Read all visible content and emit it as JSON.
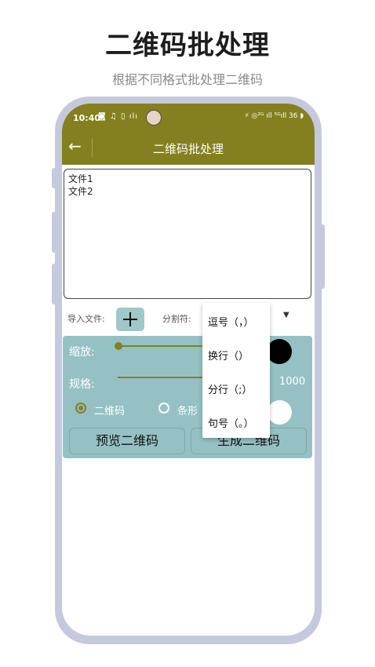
{
  "headline": "二维码批处理",
  "subheadline": "根据不同格式批处理二维码",
  "status": {
    "time": "10:40",
    "icons_left": "◙ ♫ ▯ ılı",
    "icons_right": "⚡ ◎²ᴳ ıll ⁵ᴳıll 36 ◗"
  },
  "app": {
    "title": "二维码批处理",
    "back_icon": "←"
  },
  "textarea": {
    "lines": [
      "文件1",
      "文件2"
    ]
  },
  "import": {
    "label": "导入文件:",
    "separator_label": "分割符:",
    "caret": "▼"
  },
  "settings": {
    "zoom_label": "缩放:",
    "spec_label": "规格:",
    "spec_value": "1000",
    "radio_qr": "二维码",
    "radio_bar": "条形",
    "preview_button": "预览二维码",
    "generate_button": "生成二维码"
  },
  "dropdown": {
    "options": [
      "逗号（，）",
      "换行（）",
      "分行（;）",
      "句号（。）"
    ]
  },
  "colors": {
    "accent": "#85801f",
    "panel": "#95c1c4",
    "frame": "#c4c9de"
  }
}
